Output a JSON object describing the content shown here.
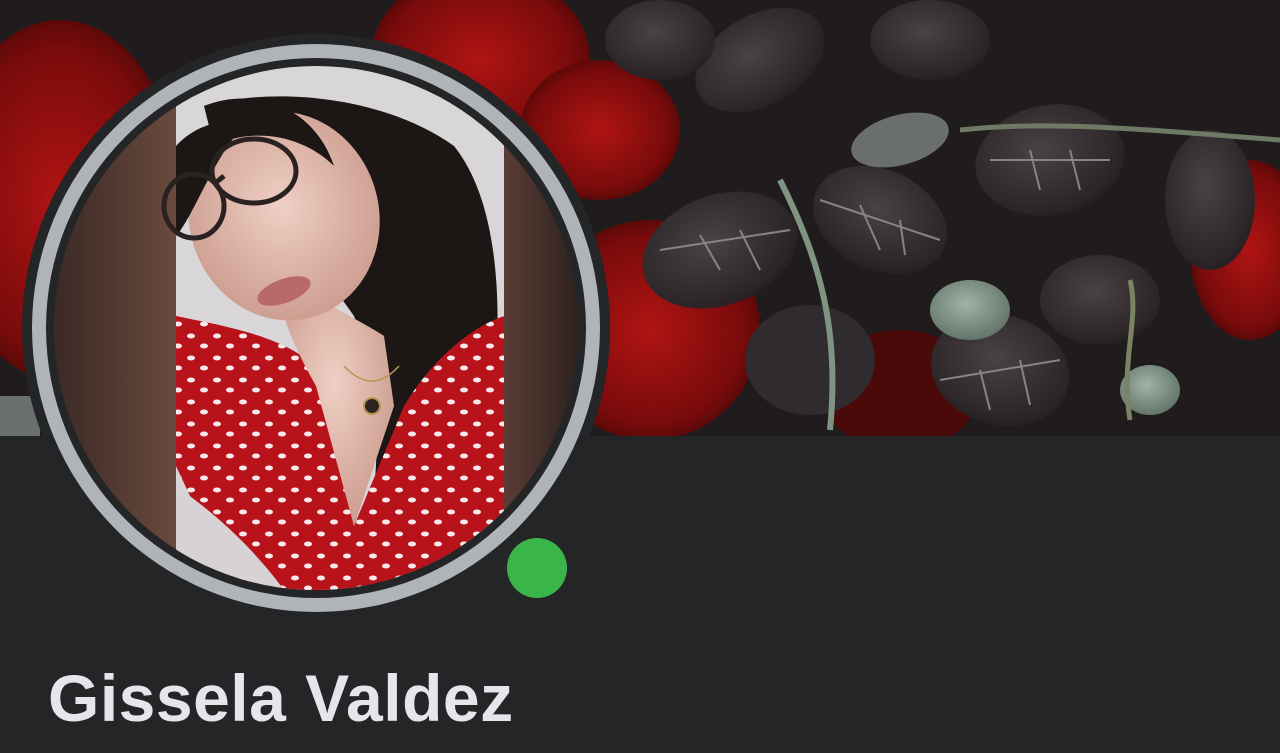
{
  "profile": {
    "name": "Gissela Valdez",
    "online_status": "online",
    "status_color": "#3ab54a"
  },
  "cover": {
    "content": "cover-photo"
  },
  "avatar": {
    "content": "profile-photo"
  },
  "theme": {
    "background": "#242526",
    "text": "#e4e6eb",
    "ring": "#b0b3b8"
  }
}
